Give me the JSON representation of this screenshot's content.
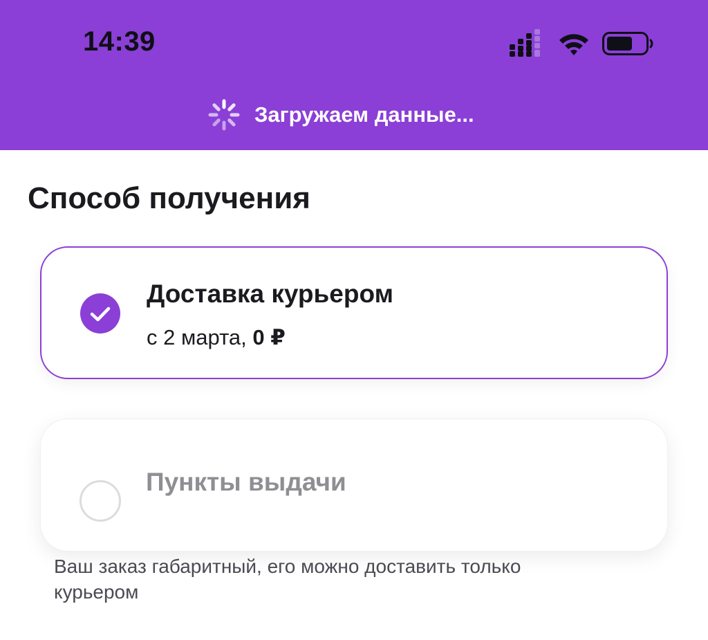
{
  "status_bar": {
    "time": "14:39",
    "icons": [
      "cellular-signal-icon",
      "wifi-icon",
      "battery-icon"
    ]
  },
  "header": {
    "loading_text": "Загружаем данные...",
    "background_color": "#8b3fd6"
  },
  "delivery": {
    "title": "Способ получения",
    "options": [
      {
        "title": "Доставка курьером",
        "date_text": "с 2 марта,",
        "price": "0 ₽",
        "selected": true
      },
      {
        "title": "Пункты выдачи",
        "selected": false,
        "disabled": true
      }
    ],
    "note": "Ваш заказ габаритный, его можно доставить только курьером"
  },
  "colors": {
    "accent": "#8b3fd6",
    "text": "#1a1a1f",
    "muted": "#8e8e93"
  }
}
